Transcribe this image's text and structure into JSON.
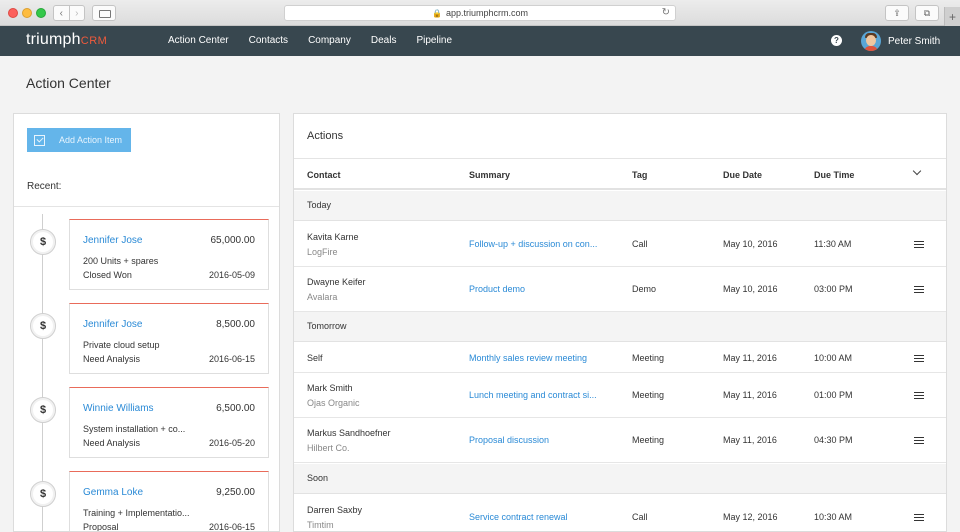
{
  "browser": {
    "url": "app.triumphcrm.com"
  },
  "app": {
    "logo_main": "triumph",
    "logo_suffix": "CRM",
    "nav": [
      "Action Center",
      "Contacts",
      "Company",
      "Deals",
      "Pipeline"
    ],
    "help": "?",
    "user_name": "Peter Smith"
  },
  "page": {
    "title": "Action Center"
  },
  "left_panel": {
    "add_button": "Add Action Item",
    "recent_label": "Recent:",
    "deals": [
      {
        "icon": "$",
        "name": "Jennifer Jose",
        "amount": "65,000.00",
        "desc": "200 Units + spares",
        "stage": "Closed Won",
        "date": "2016-05-09"
      },
      {
        "icon": "$",
        "name": "Jennifer Jose",
        "amount": "8,500.00",
        "desc": "Private cloud setup",
        "stage": "Need Analysis",
        "date": "2016-06-15"
      },
      {
        "icon": "$",
        "name": "Winnie Williams",
        "amount": "6,500.00",
        "desc": "System installation + co...",
        "stage": "Need Analysis",
        "date": "2016-05-20"
      },
      {
        "icon": "$",
        "name": "Gemma Loke",
        "amount": "9,250.00",
        "desc": "Training + Implementatio...",
        "stage": "Proposal",
        "date": "2016-06-15"
      }
    ]
  },
  "actions": {
    "title": "Actions",
    "columns": [
      "Contact",
      "Summary",
      "Tag",
      "Due Date",
      "Due Time"
    ],
    "groups": [
      {
        "label": "Today",
        "rows": [
          {
            "contact": "Kavita Karne",
            "company": "LogFire",
            "summary": "Follow-up + discussion on con...",
            "tag": "Call",
            "date": "May 10, 2016",
            "time": "11:30 AM"
          },
          {
            "contact": "Dwayne Keifer",
            "company": "Avalara",
            "summary": "Product demo",
            "tag": "Demo",
            "date": "May 10, 2016",
            "time": "03:00 PM"
          }
        ]
      },
      {
        "label": "Tomorrow",
        "rows": [
          {
            "contact": "Self",
            "company": "",
            "summary": "Monthly sales review meeting",
            "tag": "Meeting",
            "date": "May 11, 2016",
            "time": "10:00 AM"
          },
          {
            "contact": "Mark Smith",
            "company": "Ojas Organic",
            "summary": "Lunch meeting and contract si...",
            "tag": "Meeting",
            "date": "May 11, 2016",
            "time": "01:00 PM"
          },
          {
            "contact": "Markus Sandhoefner",
            "company": "Hilbert Co.",
            "summary": "Proposal discussion",
            "tag": "Meeting",
            "date": "May 11, 2016",
            "time": "04:30 PM"
          }
        ]
      },
      {
        "label": "Soon",
        "rows": [
          {
            "contact": "Darren Saxby",
            "company": "Timtim",
            "summary": "Service contract renewal",
            "tag": "Call",
            "date": "May 12, 2016",
            "time": "10:30 AM"
          }
        ]
      }
    ]
  },
  "colors": {
    "appbar": "#38474f",
    "brand_accent": "#ef5a3c",
    "link": "#2a8ad6",
    "button": "#64b5ea",
    "deal_border": "#e96b5a"
  }
}
